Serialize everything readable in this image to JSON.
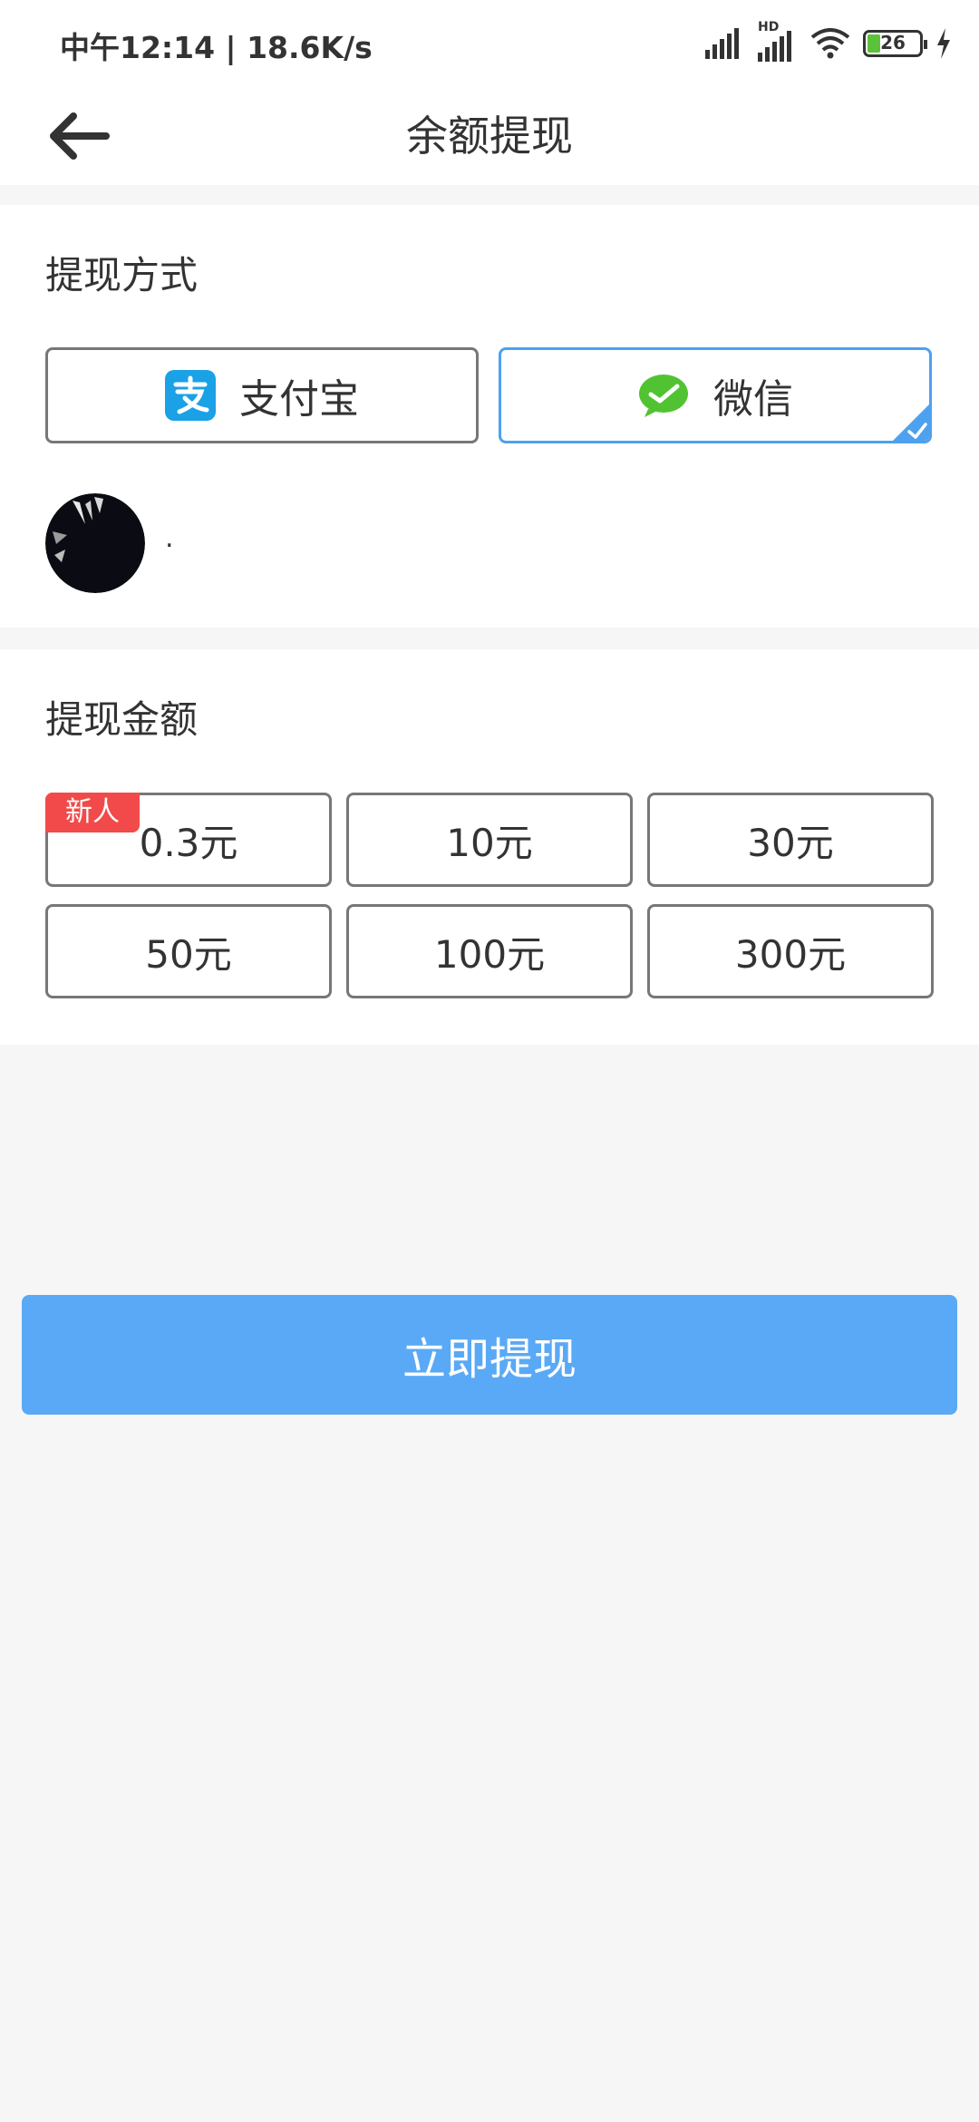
{
  "status_bar": {
    "time": "中午12:14 | 18.6K/s",
    "hd_label": "HD",
    "battery": "26"
  },
  "header": {
    "title": "余额提现"
  },
  "withdraw_method": {
    "title": "提现方式",
    "options": [
      {
        "label": "支付宝",
        "icon": "alipay-icon",
        "selected": false
      },
      {
        "label": "微信",
        "icon": "wechat-icon",
        "selected": true
      }
    ],
    "account_name": "."
  },
  "withdraw_amount": {
    "title": "提现金额",
    "badge": "新人",
    "options": [
      "0.3元",
      "10元",
      "30元",
      "50元",
      "100元",
      "300元"
    ]
  },
  "submit_label": "立即提现",
  "colors": {
    "accent": "#5aa9f6",
    "selected_border": "#4ea1ee",
    "badge": "#f24a4a",
    "alipay": "#1aa1e6",
    "wechat": "#51c332"
  }
}
